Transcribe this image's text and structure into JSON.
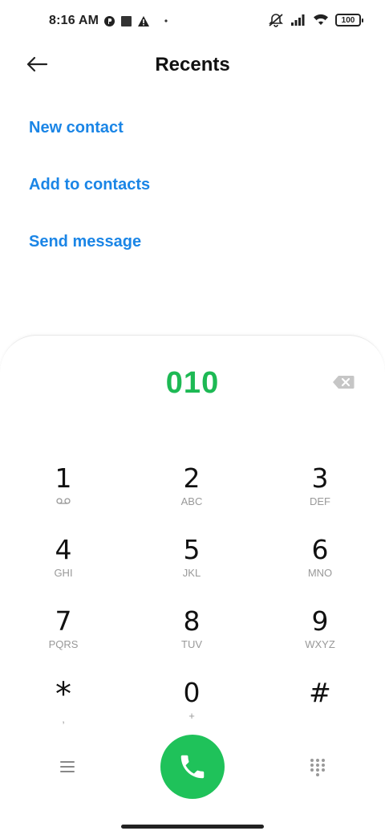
{
  "status_bar": {
    "time": "8:16 AM",
    "battery": "100",
    "icons": [
      "p-circle-icon",
      "square-icon",
      "warning-icon",
      "dot-icon",
      "silent-icon",
      "signal-icon",
      "wifi-icon",
      "battery-icon"
    ]
  },
  "header": {
    "title": "Recents",
    "back_icon": "back-arrow-icon"
  },
  "actions": [
    {
      "label": "New contact"
    },
    {
      "label": "Add to contacts"
    },
    {
      "label": "Send message"
    }
  ],
  "dialer": {
    "number": "010",
    "accent_color": "#1db954",
    "keys": [
      {
        "digit": "1",
        "letters": ""
      },
      {
        "digit": "2",
        "letters": "ABC"
      },
      {
        "digit": "3",
        "letters": "DEF"
      },
      {
        "digit": "4",
        "letters": "GHI"
      },
      {
        "digit": "5",
        "letters": "JKL"
      },
      {
        "digit": "6",
        "letters": "MNO"
      },
      {
        "digit": "7",
        "letters": "PQRS"
      },
      {
        "digit": "8",
        "letters": "TUV"
      },
      {
        "digit": "9",
        "letters": "WXYZ"
      },
      {
        "digit": "*",
        "letters": ","
      },
      {
        "digit": "0",
        "letters": "+"
      },
      {
        "digit": "#",
        "letters": ""
      }
    ],
    "call_color": "#1fc25a"
  },
  "colors": {
    "link": "#1a85e6"
  }
}
